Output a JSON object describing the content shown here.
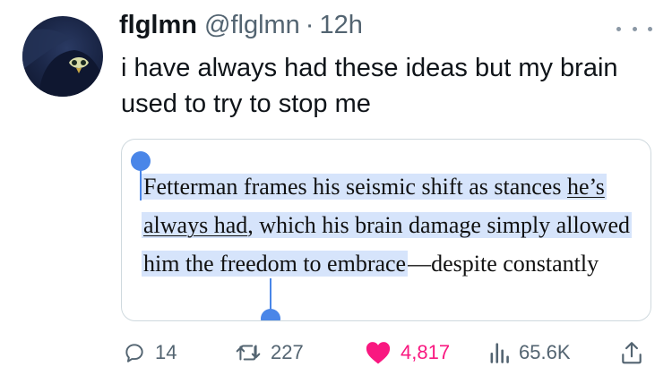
{
  "tweet": {
    "author_name": "flglmn",
    "author_handle": "@flglmn",
    "separator": "·",
    "time": "12h",
    "text": "i have always had these ideas but my brain used to try to stop me"
  },
  "quote": {
    "part1": "Fetterman frames his seismic shift as stances ",
    "underlined": "he’s always had",
    "part2": ", which his brain damage simply allowed him the freedom to embrace",
    "part3": "—despite constantly"
  },
  "actions": {
    "replies": "14",
    "retweets": "227",
    "likes": "4,817",
    "views": "65.6K"
  },
  "colors": {
    "like": "#f91880",
    "selection_handle": "#4a86e8",
    "selection_highlight": "#d6e4fb",
    "icon_gray": "#536471"
  },
  "icons": [
    "more-icon",
    "reply-icon",
    "retweet-icon",
    "like-heart-icon",
    "views-icon",
    "share-icon"
  ]
}
